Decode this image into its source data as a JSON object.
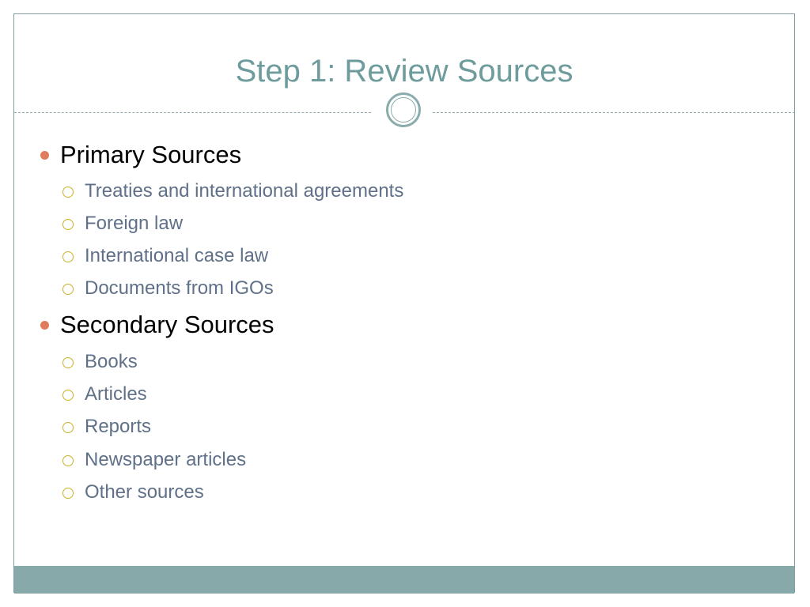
{
  "slide": {
    "title": "Step 1: Review Sources",
    "sections": [
      {
        "heading": "Primary Sources",
        "items": [
          "Treaties and international agreements",
          "Foreign law",
          "International case law",
          "Documents from IGOs"
        ]
      },
      {
        "heading": "Secondary Sources",
        "items": [
          "Books",
          "Articles",
          "Reports",
          "Newspaper articles",
          "Other sources"
        ]
      }
    ]
  },
  "colors": {
    "title": "#6e9b9b",
    "accent_bar": "#87a9aa",
    "level1_bullet": "#e07b5d",
    "level2_bullet": "#c9b226",
    "level2_text": "#5f7088"
  }
}
